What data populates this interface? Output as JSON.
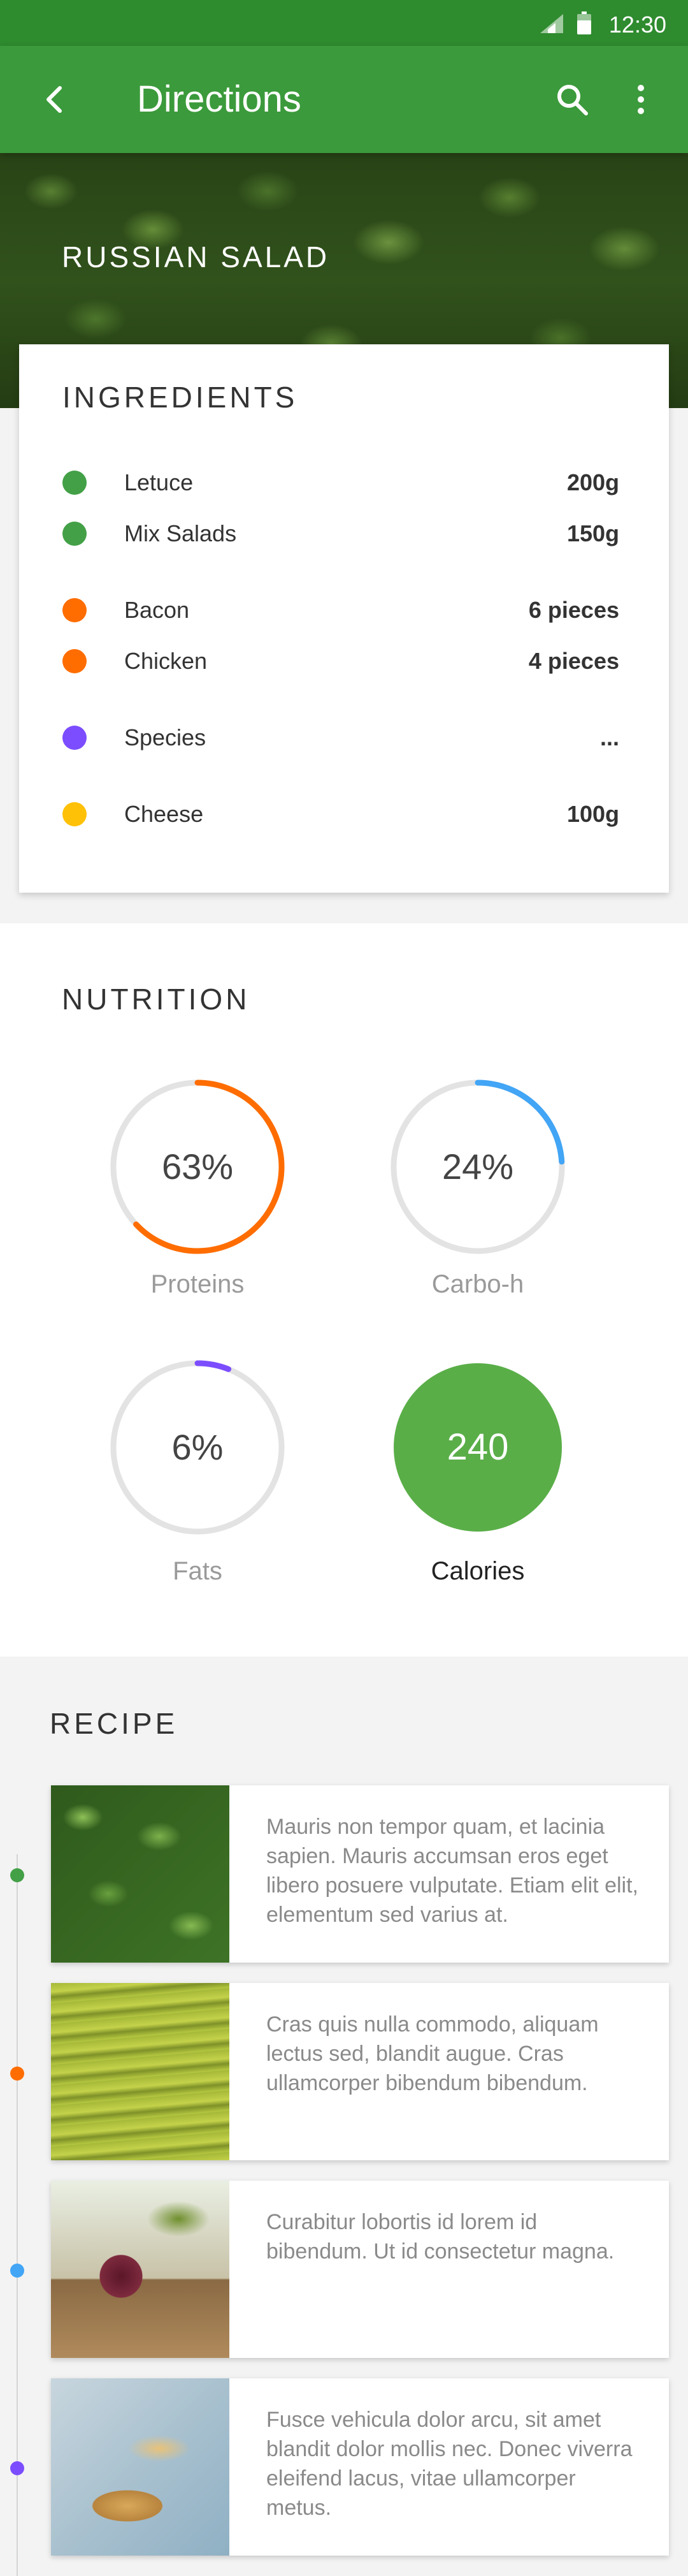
{
  "status_bar": {
    "time": "12:30"
  },
  "app_bar": {
    "title": "Directions"
  },
  "hero": {
    "recipe_name": "RUSSIAN SALAD"
  },
  "ingredients": {
    "heading": "INGREDIENTS",
    "items": [
      {
        "name": "Letuce",
        "quantity": "200g",
        "color": "#43a047"
      },
      {
        "name": "Mix Salads",
        "quantity": "150g",
        "color": "#43a047"
      },
      {
        "name": "Bacon",
        "quantity": "6 pieces",
        "color": "#ff6d00"
      },
      {
        "name": "Chicken",
        "quantity": "4 pieces",
        "color": "#ff6d00"
      },
      {
        "name": "Species",
        "quantity": "...",
        "color": "#7c4dff"
      },
      {
        "name": "Cheese",
        "quantity": "100g",
        "color": "#ffc107"
      }
    ]
  },
  "nutrition": {
    "heading": "NUTRITION",
    "gauges": [
      {
        "label": "Proteins",
        "percent_text": "63%",
        "value": 0.63,
        "color": "#ff6d00"
      },
      {
        "label": "Carbo-h",
        "percent_text": "24%",
        "value": 0.24,
        "color": "#42a5f5"
      },
      {
        "label": "Fats",
        "percent_text": "6%",
        "value": 0.06,
        "color": "#7c4dff"
      }
    ],
    "calories": {
      "value": "240",
      "label": "Calories",
      "color": "#5aae48"
    }
  },
  "recipe": {
    "heading": "RECIPE",
    "steps": [
      {
        "text": "Mauris non tempor quam, et lacinia sapien. Mauris accumsan eros eget libero posuere vulputate. Etiam elit elit, elementum sed varius at.",
        "dot_color": "#43a047",
        "image": "lettuce-photo"
      },
      {
        "text": "Cras quis nulla commodo, aliquam lectus sed, blandit augue. Cras ullamcorper bibendum bibendum.",
        "dot_color": "#ff6d00",
        "image": "pasta-photo"
      },
      {
        "text": "Curabitur lobortis id lorem id bibendum. Ut id consectetur magna.",
        "dot_color": "#42a5f5",
        "image": "onion-spices-photo"
      },
      {
        "text": "Fusce vehicula dolor arcu, sit amet blandit dolor mollis nec. Donec viverra eleifend lacus, vitae ullamcorper metus.",
        "dot_color": "#7c4dff",
        "image": "bread-photo"
      }
    ]
  }
}
